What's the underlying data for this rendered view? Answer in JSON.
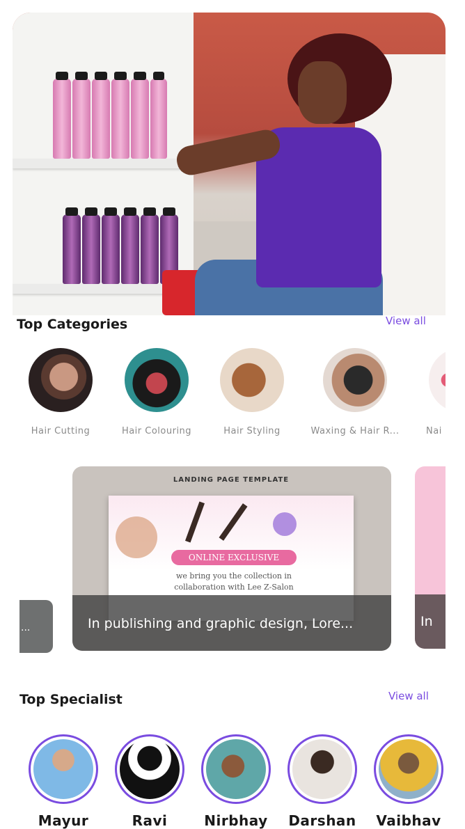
{
  "hero": {
    "alt_icon": "hero-store-photo"
  },
  "categories": {
    "title": "Top Categories",
    "view_all": "View all",
    "items": [
      {
        "label": "Hair Cutting"
      },
      {
        "label": "Hair Colouring"
      },
      {
        "label": "Hair Styling"
      },
      {
        "label": "Waxing & Hair R..."
      },
      {
        "label": "Nai"
      }
    ]
  },
  "banners": {
    "left_caption": "...",
    "main_template_title": "LANDING PAGE TEMPLATE",
    "main_pill": "ONLINE EXCLUSIVE",
    "main_text": "we bring you the collection in collaboration with Lee Z-Salon",
    "main_caption": "In publishing and graphic design, Lore...",
    "right_caption": "In"
  },
  "specialists": {
    "title": "Top Specialist",
    "view_all": "View all",
    "items": [
      {
        "name": "Mayur"
      },
      {
        "name": "Ravi"
      },
      {
        "name": "Nirbhay"
      },
      {
        "name": "Darshan"
      },
      {
        "name": "Vaibhav"
      }
    ]
  },
  "colors": {
    "accent": "#7a4ce0",
    "title": "#1a1a1a",
    "muted": "#8a8a8a"
  }
}
